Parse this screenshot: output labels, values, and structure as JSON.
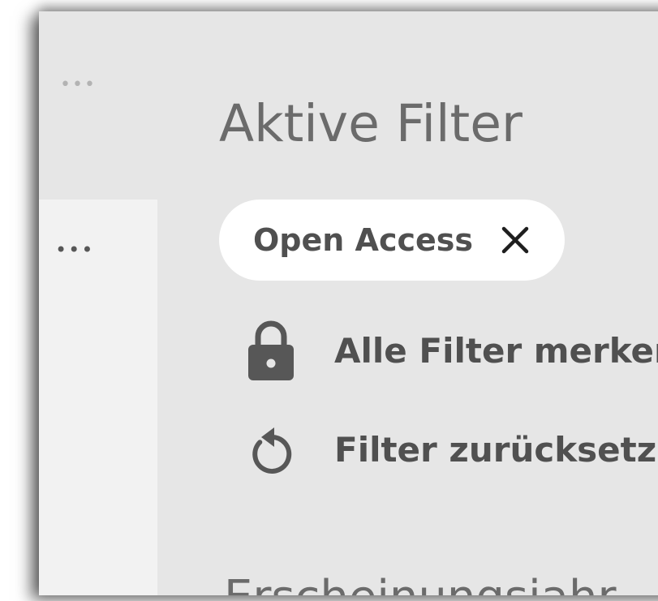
{
  "top_more_label": "•••",
  "side": {
    "more_label": "•••"
  },
  "filters": {
    "title": "Aktive Filter",
    "active_chips": [
      {
        "label": "Open Access",
        "remove_icon": "close-icon"
      }
    ],
    "actions": [
      {
        "label": "Alle Filter merker",
        "icon": "lock-icon"
      },
      {
        "label": "Filter zurücksetz",
        "icon": "reset-icon"
      }
    ],
    "next_heading": "Erscheinungsjahr"
  },
  "colors": {
    "panel_bg": "#e6e6e6",
    "side_bg": "#f2f2f2",
    "chip_bg": "#ffffff",
    "text": "#505050",
    "title": "#6b6b6b"
  }
}
